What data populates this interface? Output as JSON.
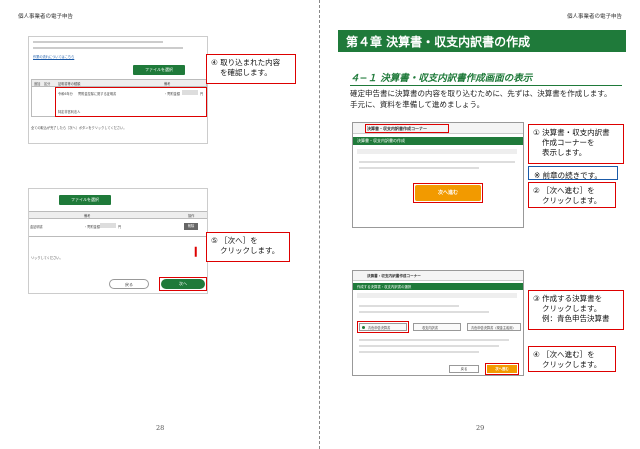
{
  "header_title": "個人事業者の電子申告",
  "left_page": {
    "page_number": "28",
    "callout4": {
      "number": "④",
      "lines": [
        "取り込まれた内容",
        "を確認します。"
      ]
    },
    "callout5": {
      "number": "⑤",
      "lines": [
        "［次へ］を",
        "クリックします。"
      ]
    },
    "shot1": {
      "file_button": "ファイルを選択",
      "columns": [
        "追加",
        "区分",
        "証明書等の種類",
        "備考"
      ],
      "row_text": [
        "令和6年分",
        "寄附金控除に関する証明書"
      ],
      "row_note": "・寄附金額",
      "row_unit": "円",
      "org": "特定非営利法人",
      "footer": "全ての取込が完了したら［次へ］ボタンをクリックしてください。",
      "link": "作業の流れについてはこちら"
    },
    "shot2": {
      "file_button": "ファイルを選択",
      "columns": [
        "備考",
        "操作"
      ],
      "row_label": "金証明書",
      "row_note": "・寄附金額",
      "row_unit": "円",
      "delete": "削除",
      "footer": "リックしてください。",
      "back": "戻る",
      "next": "次へ"
    }
  },
  "right_page": {
    "page_number": "29",
    "chapter_title": "第４章 決算書・収支内訳書の作成",
    "section_title": "４−１ 決算書・収支内訳書作成画面の表示",
    "intro": [
      "確定申告書に決算書の内容を取り込むために、先ずは、決算書を作成します。",
      "手元に、資料を準備して進めましょう。"
    ],
    "callout1": {
      "number": "①",
      "lines": [
        "決算書・収支内訳書",
        "作成コーナーを",
        "表示します。"
      ]
    },
    "note": "※ 前章の続きです。",
    "callout2": {
      "number": "②",
      "lines": [
        "［次へ進む］を",
        "クリックします。"
      ]
    },
    "callout3": {
      "number": "③",
      "lines": [
        "作成する決算書を",
        "クリックします。",
        "例：青色申告決算書"
      ]
    },
    "callout4": {
      "number": "④",
      "lines": [
        "［次へ進む］を",
        "クリックします。"
      ]
    },
    "shotA": {
      "corner_title": "決算書・収支内訳書作成コーナー",
      "green_bar": "決算書・収支内訳書の作成",
      "next_button": "次へ進む"
    },
    "shotB": {
      "corner_title": "決算書・収支内訳書作成コーナー",
      "green_bar": "作成する決算書・収支内訳書の選択",
      "option1": "青色申告決算書",
      "option2": "収支内訳書",
      "option3": "青色申告決算書（現金主義用）",
      "back": "戻る",
      "next": "次へ進む"
    }
  }
}
